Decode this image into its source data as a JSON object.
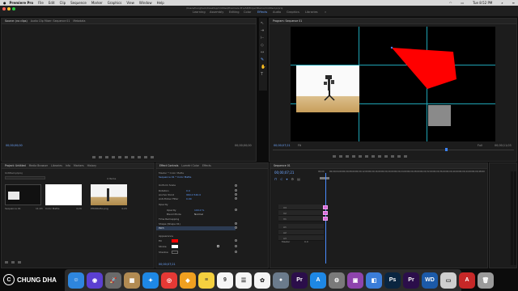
{
  "menubar": {
    "apple": "",
    "app": "Premiere Pro",
    "items": [
      "File",
      "Edit",
      "Clip",
      "Sequence",
      "Marker",
      "Graphics",
      "View",
      "Window",
      "Help"
    ],
    "clock": "Tue 8:52 PM"
  },
  "header": {
    "document_title": "/Users/hunghack/Desktop/Untitled/Premiere Pro/AE/ProjectDemo/Untitled.prproj",
    "workspaces": [
      "Learning",
      "Assembly",
      "Editing",
      "Color",
      "Effects",
      "Audio",
      "Graphics",
      "Libraries"
    ],
    "active_workspace": "Effects",
    "more": "»"
  },
  "source_panel": {
    "tabs": [
      "Source: (no clips)",
      "Audio Clip Mixer: Sequence 01",
      "Metadata"
    ],
    "timecode_left": "00;00;00;00",
    "timecode_right": "00;00;00;00"
  },
  "program_panel": {
    "tab": "Program: Sequence 01",
    "timecode": "00;00;07;21",
    "fit": "Fit",
    "quality": "Full",
    "duration": "00;00;11;03"
  },
  "project_panel": {
    "tabs": [
      "Project: Untitled",
      "Media Browser",
      "Libraries",
      "Info",
      "Markers",
      "History"
    ],
    "path": "Untitled.prproj",
    "item_count": "4 Items",
    "items": [
      {
        "name": "Sequence 01",
        "duration": "11;03"
      },
      {
        "name": "Color Matte",
        "duration": "4;29"
      },
      {
        "name": "PHUNGHA.png",
        "duration": "4;29"
      }
    ]
  },
  "effect_controls": {
    "tabs": [
      "Effect Controls",
      "Lumetri Color",
      "Effects"
    ],
    "master": "Master * Color Matte",
    "sequence": "Sequence 01 * Color Matte",
    "rows": [
      {
        "label": "Uniform Scale",
        "value": ""
      },
      {
        "label": "Rotation",
        "value": "0.0"
      },
      {
        "label": "Anchor Point",
        "value": "960.0   540.0"
      },
      {
        "label": "Anti-flicker Filter",
        "value": "0.00"
      },
      {
        "label": "Opacity",
        "value": ""
      },
      {
        "label": "Opacity",
        "value": "100.0 %"
      },
      {
        "label": "Blend Mode",
        "value": "Normal"
      },
      {
        "label": "Time Remapping",
        "value": ""
      },
      {
        "label": "Shape (Shape 01)",
        "value": ""
      },
      {
        "label": "Path",
        "value": ""
      },
      {
        "label": "Appearance",
        "value": ""
      },
      {
        "label": "Fill",
        "value": ""
      },
      {
        "label": "Stroke",
        "value": ""
      },
      {
        "label": "Shadow",
        "value": ""
      }
    ],
    "timecode": "00;00;07;21"
  },
  "timeline": {
    "tab": "Sequence 01",
    "timecode": "00;00;07;21",
    "ruler": [
      "00;00",
      "00;00;04;00",
      "00;00;08;00",
      "00;00;12;00",
      "00;00;16;00",
      "00;00;20;00",
      "00;00;24;00",
      "00;00;28;00",
      "00;00;32;00",
      "00;00;36;00",
      "00;00;40;00",
      "00;00;44;00",
      "00;00;48;00"
    ],
    "video_tracks": [
      "V3",
      "V2",
      "V1"
    ],
    "audio_tracks": [
      "A1",
      "A2",
      "A3"
    ],
    "master": "Master",
    "master_value": "0.0"
  },
  "watermark": {
    "text": "CHUNG DHA"
  },
  "dock": {
    "icons": [
      {
        "name": "finder",
        "glyph": "☺",
        "color": "#2e86de"
      },
      {
        "name": "siri",
        "glyph": "◉",
        "color": "#5b3fd1"
      },
      {
        "name": "launchpad",
        "glyph": "🚀",
        "color": "#6a6a6a"
      },
      {
        "name": "folder",
        "glyph": "▦",
        "color": "#b28b52"
      },
      {
        "name": "safari",
        "glyph": "✦",
        "color": "#1e88e5"
      },
      {
        "name": "chrome",
        "glyph": "◎",
        "color": "#e53935"
      },
      {
        "name": "sketch",
        "glyph": "◆",
        "color": "#f0a020"
      },
      {
        "name": "notes",
        "glyph": "≡",
        "color": "#f4d03f"
      },
      {
        "name": "calendar",
        "glyph": "9",
        "color": "#f5f5f5"
      },
      {
        "name": "reminders",
        "glyph": "☰",
        "color": "#f5f5f5"
      },
      {
        "name": "photos",
        "glyph": "✿",
        "color": "#f5f5f5"
      },
      {
        "name": "photo-booth",
        "glyph": "●",
        "color": "#6b7b8c"
      },
      {
        "name": "premiere",
        "glyph": "Pr",
        "color": "#2b0e4a"
      },
      {
        "name": "app-store",
        "glyph": "A",
        "color": "#1e88e5"
      },
      {
        "name": "preferences",
        "glyph": "⚙",
        "color": "#7a7a7a"
      },
      {
        "name": "mockup",
        "glyph": "▣",
        "color": "#8e44ad"
      },
      {
        "name": "chat",
        "glyph": "◧",
        "color": "#3b7dd8"
      },
      {
        "name": "photoshop",
        "glyph": "Ps",
        "color": "#0a2540"
      },
      {
        "name": "premiere-2",
        "glyph": "Pr",
        "color": "#2b0e4a"
      },
      {
        "name": "wd-drive",
        "glyph": "WD",
        "color": "#1c5aa8"
      },
      {
        "name": "drive",
        "glyph": "▭",
        "color": "#cfcfcf"
      },
      {
        "name": "acrobat",
        "glyph": "A",
        "color": "#c62828"
      },
      {
        "name": "trash",
        "glyph": "🗑",
        "color": "#9a9a9a"
      }
    ]
  }
}
